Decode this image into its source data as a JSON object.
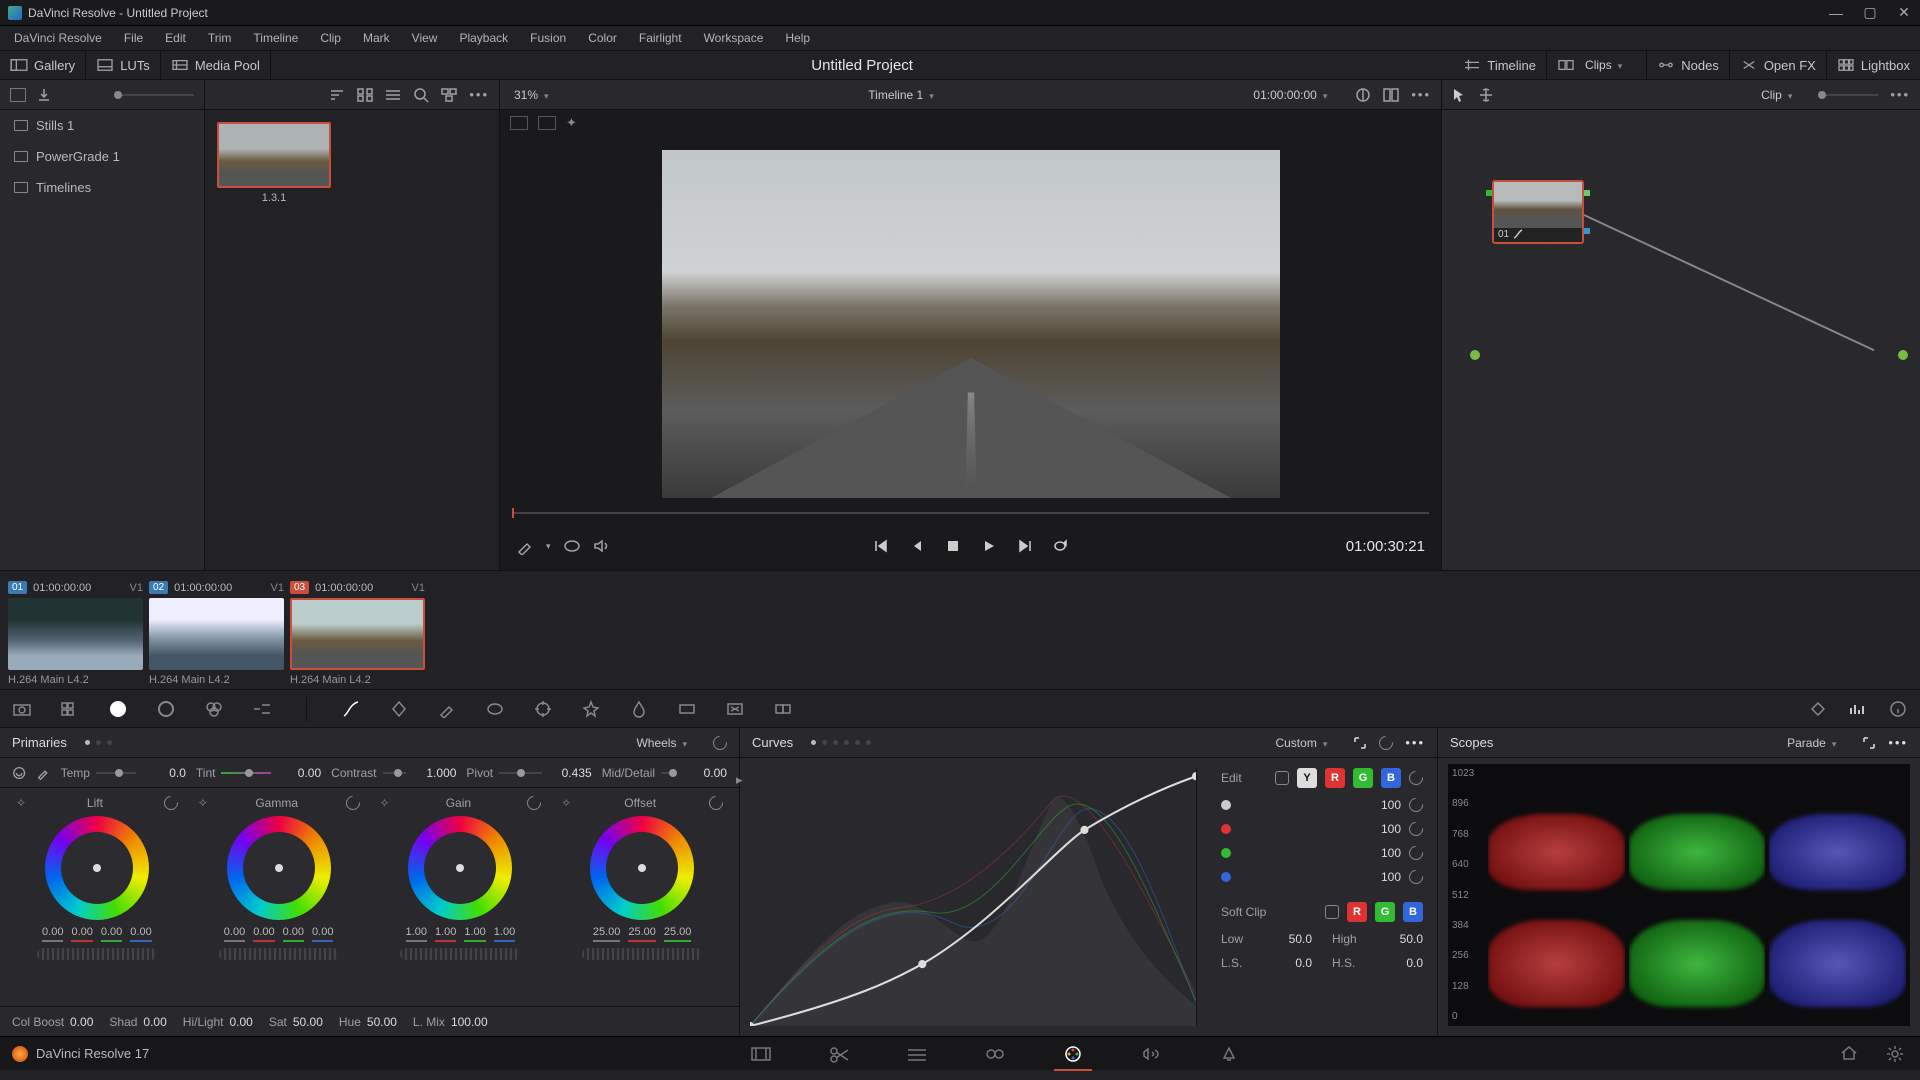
{
  "titlebar": {
    "text": "DaVinci Resolve - Untitled Project"
  },
  "menu": [
    "DaVinci Resolve",
    "File",
    "Edit",
    "Trim",
    "Timeline",
    "Clip",
    "Mark",
    "View",
    "Playback",
    "Fusion",
    "Color",
    "Fairlight",
    "Workspace",
    "Help"
  ],
  "toolbar": {
    "gallery": "Gallery",
    "luts": "LUTs",
    "mediapool": "Media Pool",
    "timeline": "Timeline",
    "clips": "Clips",
    "nodes": "Nodes",
    "openfx": "Open FX",
    "lightbox": "Lightbox",
    "project_title": "Untitled Project"
  },
  "subbar": {
    "zoom": "31%",
    "timeline_name": "Timeline 1",
    "timecode": "01:00:00:00",
    "node_mode": "Clip"
  },
  "gallery": {
    "items": [
      "Stills 1",
      "PowerGrade 1",
      "Timelines"
    ],
    "still_label": "1.3.1"
  },
  "transport": {
    "end_tc": "01:00:30:21"
  },
  "clips": [
    {
      "num": "01",
      "tc": "01:00:00:00",
      "track": "V1",
      "codec": "H.264 Main L4.2"
    },
    {
      "num": "02",
      "tc": "01:00:00:00",
      "track": "V1",
      "codec": "H.264 Main L4.2"
    },
    {
      "num": "03",
      "tc": "01:00:00:00",
      "track": "V1",
      "codec": "H.264 Main L4.2"
    }
  ],
  "node": {
    "label": "01"
  },
  "primaries": {
    "title": "Primaries",
    "mode": "Wheels",
    "temp_label": "Temp",
    "temp": "0.0",
    "tint_label": "Tint",
    "tint": "0.00",
    "contrast_label": "Contrast",
    "contrast": "1.000",
    "pivot_label": "Pivot",
    "pivot": "0.435",
    "md_label": "Mid/Detail",
    "md": "0.00",
    "wheels": [
      {
        "name": "Lift",
        "vals": [
          "0.00",
          "0.00",
          "0.00",
          "0.00"
        ]
      },
      {
        "name": "Gamma",
        "vals": [
          "0.00",
          "0.00",
          "0.00",
          "0.00"
        ]
      },
      {
        "name": "Gain",
        "vals": [
          "1.00",
          "1.00",
          "1.00",
          "1.00"
        ]
      },
      {
        "name": "Offset",
        "vals": [
          "25.00",
          "25.00",
          "25.00"
        ]
      }
    ],
    "foot": {
      "colboost_l": "Col Boost",
      "colboost": "0.00",
      "shad_l": "Shad",
      "shad": "0.00",
      "hl_l": "Hi/Light",
      "hl": "0.00",
      "sat_l": "Sat",
      "sat": "50.00",
      "hue_l": "Hue",
      "hue": "50.00",
      "lmix_l": "L. Mix",
      "lmix": "100.00"
    }
  },
  "curves": {
    "title": "Curves",
    "mode": "Custom",
    "edit_label": "Edit",
    "channel_values": [
      "100",
      "100",
      "100",
      "100"
    ],
    "softclip_label": "Soft Clip",
    "low_l": "Low",
    "low": "50.0",
    "high_l": "High",
    "high": "50.0",
    "ls_l": "L.S.",
    "ls": "0.0",
    "hs_l": "H.S.",
    "hs": "0.0"
  },
  "scopes": {
    "title": "Scopes",
    "mode": "Parade",
    "ticks": [
      "1023",
      "896",
      "768",
      "640",
      "512",
      "384",
      "256",
      "128",
      "0"
    ]
  },
  "pagebar": {
    "brand": "DaVinci Resolve 17"
  }
}
